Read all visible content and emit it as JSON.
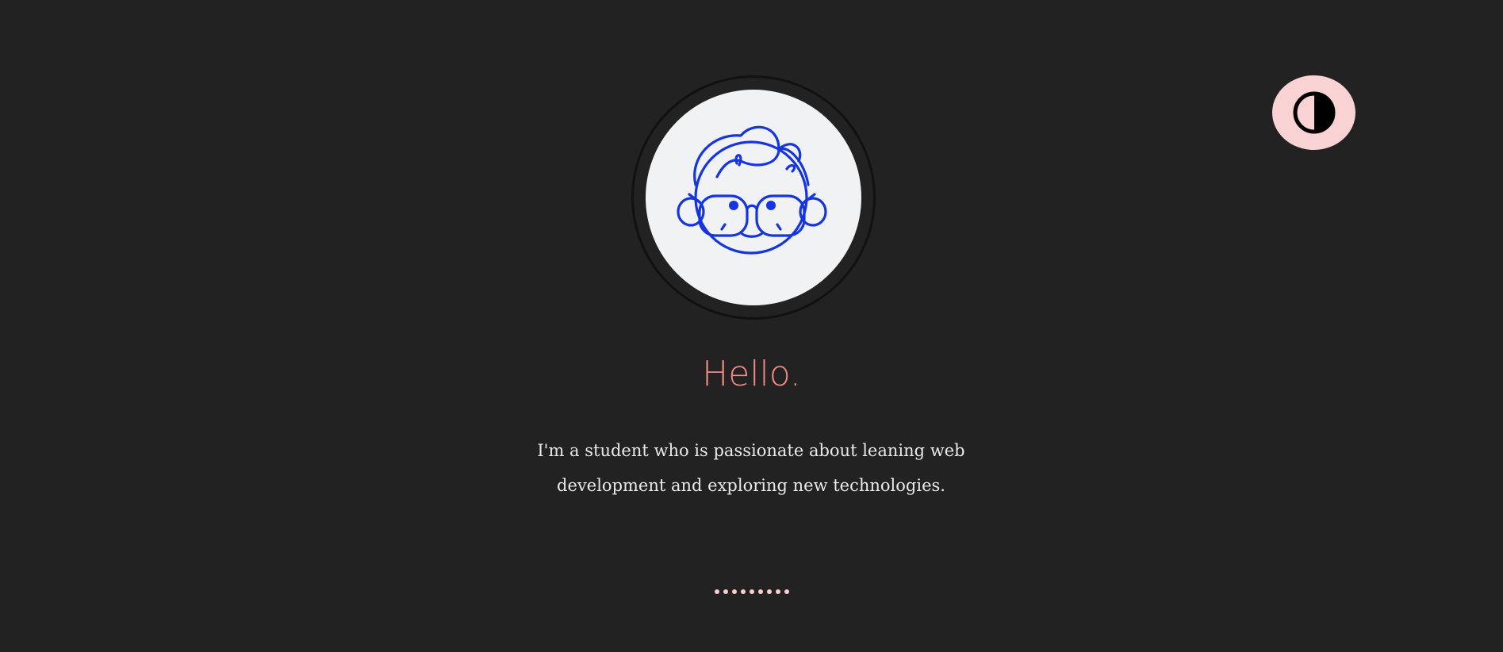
{
  "theme_toggle": {
    "icon": "half-circle-contrast-icon",
    "color": "#f9d3d3"
  },
  "avatar": {
    "icon": "glasses-face-icon",
    "stroke_color": "#1535e0",
    "background": "#f1f2f4"
  },
  "hero": {
    "greeting": "Hello.",
    "bio_line1": "I'm a student who is passionate about leaning web",
    "bio_line2": "development and exploring new technologies."
  },
  "pager": {
    "dot_count": 9,
    "color": "#f7cfd0"
  },
  "colors": {
    "background": "#222222",
    "accent": "#f08a84",
    "text": "#e9e9e9"
  }
}
